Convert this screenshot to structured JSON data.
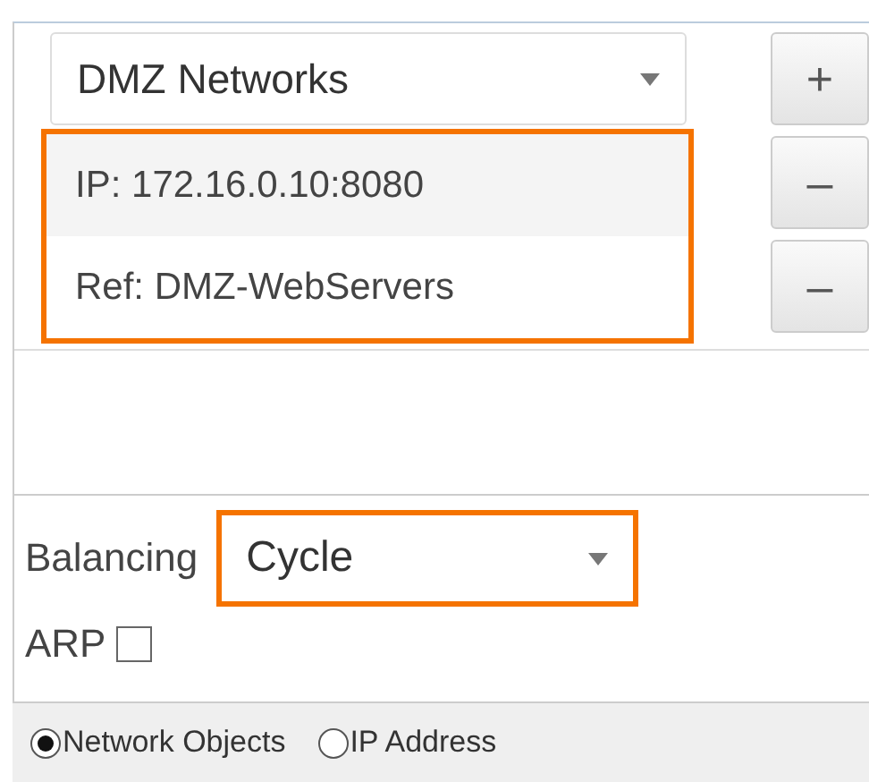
{
  "network_select": {
    "value": "DMZ Networks",
    "add_label": "+"
  },
  "entries": [
    {
      "text": "IP: 172.16.0.10:8080",
      "remove_label": "–"
    },
    {
      "text": "Ref: DMZ-WebServers",
      "remove_label": "–"
    }
  ],
  "balancing": {
    "label": "Balancing",
    "value": "Cycle"
  },
  "arp": {
    "label": "ARP",
    "checked": false
  },
  "mode": [
    {
      "label": "Network Objects",
      "selected": true
    },
    {
      "label": "IP Address",
      "selected": false
    }
  ]
}
